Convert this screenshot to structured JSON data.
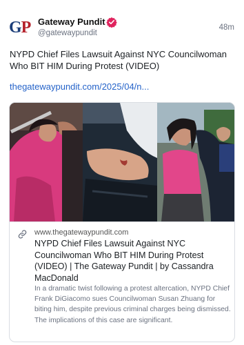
{
  "account": {
    "avatar_text_left": "G",
    "avatar_text_right": "P",
    "display_name": "Gateway Pundit",
    "handle": "@gatewaypundit",
    "timestamp": "48m",
    "verified_color": "#e0245e",
    "avatar_blue": "#1d3f7a",
    "avatar_red": "#b5202a"
  },
  "post": {
    "text": "NYPD Chief Files Lawsuit Against NYC Councilwoman Who BIT HIM During Protest (VIDEO)",
    "link_text": "thegatewaypundit.com/2025/04/n...",
    "link_color": "#2563c9"
  },
  "link_card": {
    "image_alt": "Protest altercation photos",
    "link_icon": "link-chain-icon",
    "domain": "www.thegatewaypundit.com",
    "title": "NYPD Chief Files Lawsuit Against NYC Councilwoman Who BIT HIM During Protest (VIDEO) | The Gateway Pundit | by Cassandra MacDonald",
    "description": "In a dramatic twist following a protest altercation, NYPD Chief Frank DiGiacomo sues Councilwoman Susan Zhuang for biting him, despite previous criminal charges being dismissed. The implications of this case are significant."
  }
}
